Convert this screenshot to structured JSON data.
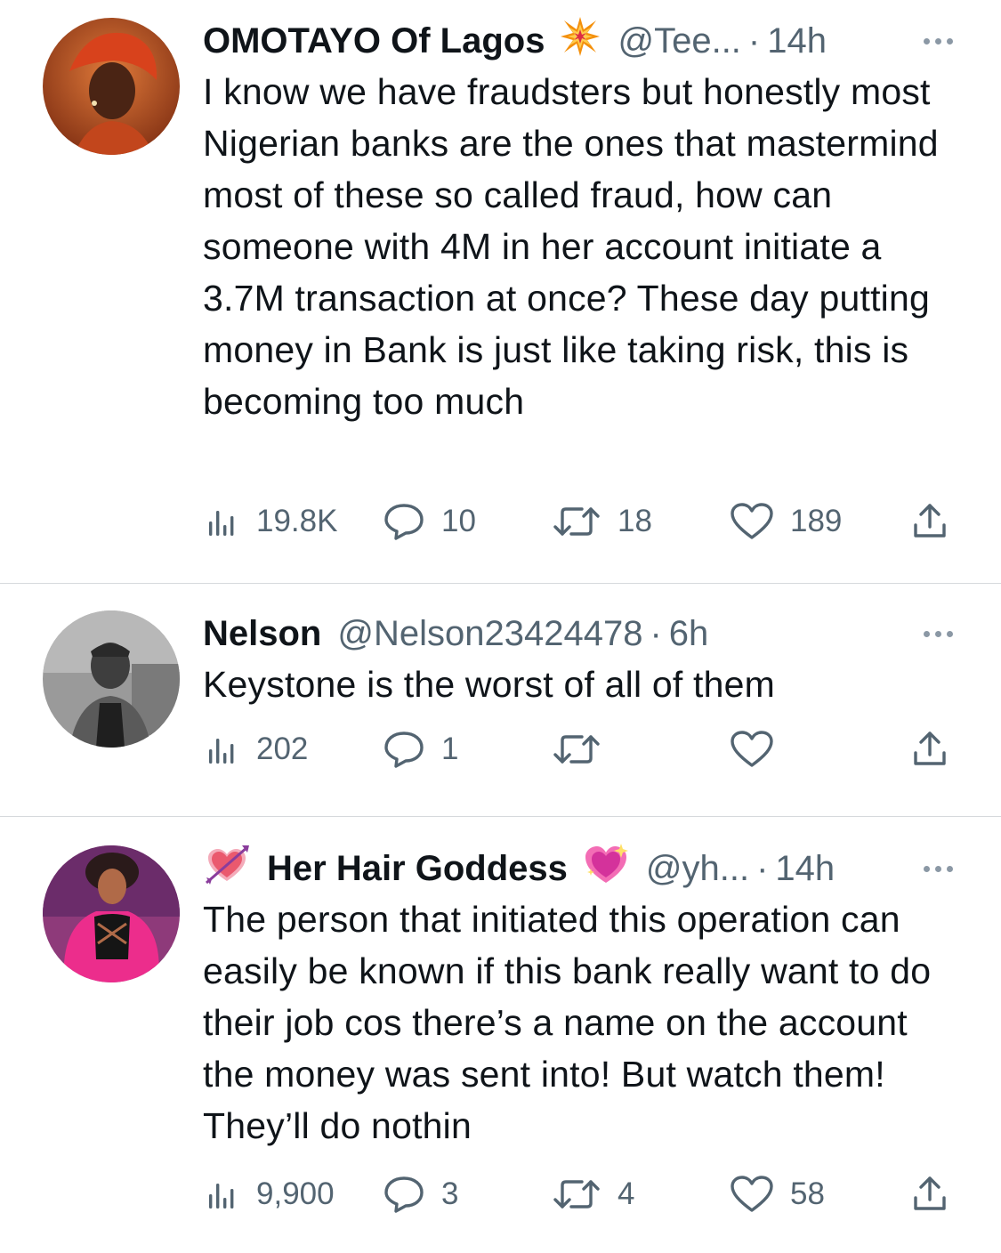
{
  "tweets": [
    {
      "name": "OMOTAYO Of Lagos",
      "handle": "@Tee...",
      "dot": "·",
      "time": "14h",
      "text": "I know we have fraudsters but honestly most Nigerian banks are the ones that mastermind most of these so called fraud, how can someone with 4M in her account initiate a 3.7M transaction at once? These day putting money in Bank is just like taking risk, this is becoming too much",
      "views": "19.8K",
      "replies": "10",
      "retweets": "18",
      "likes": "189"
    },
    {
      "name": "Nelson",
      "handle": "@Nelson23424478",
      "dot": "·",
      "time": "6h",
      "text": "Keystone is the worst of all of them",
      "views": "202",
      "replies": "1",
      "retweets": "",
      "likes": ""
    },
    {
      "name": "Her Hair Goddess",
      "handle": "@yh...",
      "dot": "·",
      "time": "14h",
      "text": "The person that initiated this operation can easily be known if this bank really want to do their job cos there’s a name on the account the money was sent into! But watch them! They’ll do nothin",
      "views": "9,900",
      "replies": "3",
      "retweets": "4",
      "likes": "58"
    }
  ],
  "icons": {
    "views": "bar-chart-icon",
    "reply": "speech-bubble-icon",
    "retweet": "retweet-icon",
    "like": "heart-icon",
    "share": "share-icon",
    "more": "ellipsis-icon",
    "collision": "collision-emoji-icon",
    "heart_arrow": "heart-with-arrow-emoji-icon",
    "sparkling_heart": "sparkling-heart-emoji-icon"
  },
  "colors": {
    "text": "#0f1419",
    "secondary": "#536471",
    "divider": "#d6d9dc"
  }
}
